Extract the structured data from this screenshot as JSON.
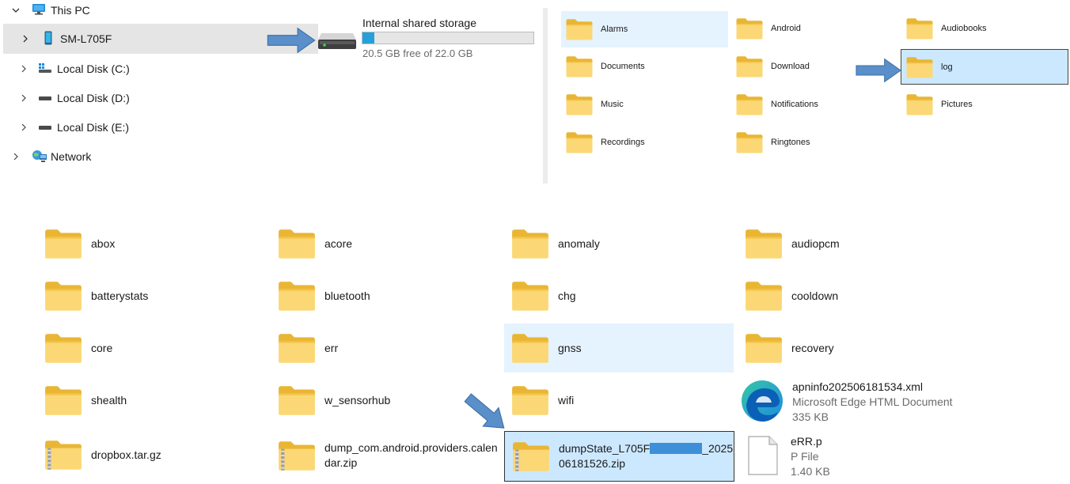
{
  "nav": {
    "this_pc": "This PC",
    "device": "SM-L705F",
    "disk_c": "Local Disk (C:)",
    "disk_d": "Local Disk (D:)",
    "disk_e": "Local Disk (E:)",
    "network": "Network"
  },
  "storage": {
    "name": "Internal shared storage",
    "free_text": "20.5 GB free of 22.0 GB",
    "used_fraction": 0.068,
    "bar_color": "#26a0da"
  },
  "device_folders": [
    "Alarms",
    "Android",
    "Audiobooks",
    "Documents",
    "Download",
    "log",
    "Music",
    "Notifications",
    "Pictures",
    "Recordings",
    "Ringtones"
  ],
  "log_items": {
    "abox": "abox",
    "acore": "acore",
    "anomaly": "anomaly",
    "audiopcm": "audiopcm",
    "batterystats": "batterystats",
    "bluetooth": "bluetooth",
    "chg": "chg",
    "cooldown": "cooldown",
    "core": "core",
    "err": "err",
    "gnss": "gnss",
    "recovery": "recovery",
    "shealth": "shealth",
    "w_sensorhub": "w_sensorhub",
    "wifi": "wifi",
    "apn_name": "apninfo202506181534.xml",
    "apn_type": "Microsoft Edge HTML Document",
    "apn_size": "335 KB",
    "dropbox": "dropbox.tar.gz",
    "dump_com_1": "dump_com.android.providers.calen",
    "dump_com_2": "dar.zip",
    "dumpstate_1a": "dumpState_L705F",
    "dumpstate_1b": "_2025",
    "dumpstate_2": "06181526.zip",
    "err_p_name": "eRR.p",
    "err_p_type": "P File",
    "err_p_size": "1.40 KB"
  },
  "colors": {
    "arrow": "#5b8fc9",
    "selection": "#cce8ff",
    "hover": "#e5f3ff",
    "folder": "#f8d775",
    "redaction": "#3d8fd8"
  },
  "icons": [
    "chevron-down-icon",
    "chevron-right-icon",
    "pc-icon",
    "phone-icon",
    "drive-icon",
    "network-icon",
    "folder-icon",
    "zip-folder-icon",
    "edge-icon",
    "file-icon",
    "arrow-icon"
  ]
}
